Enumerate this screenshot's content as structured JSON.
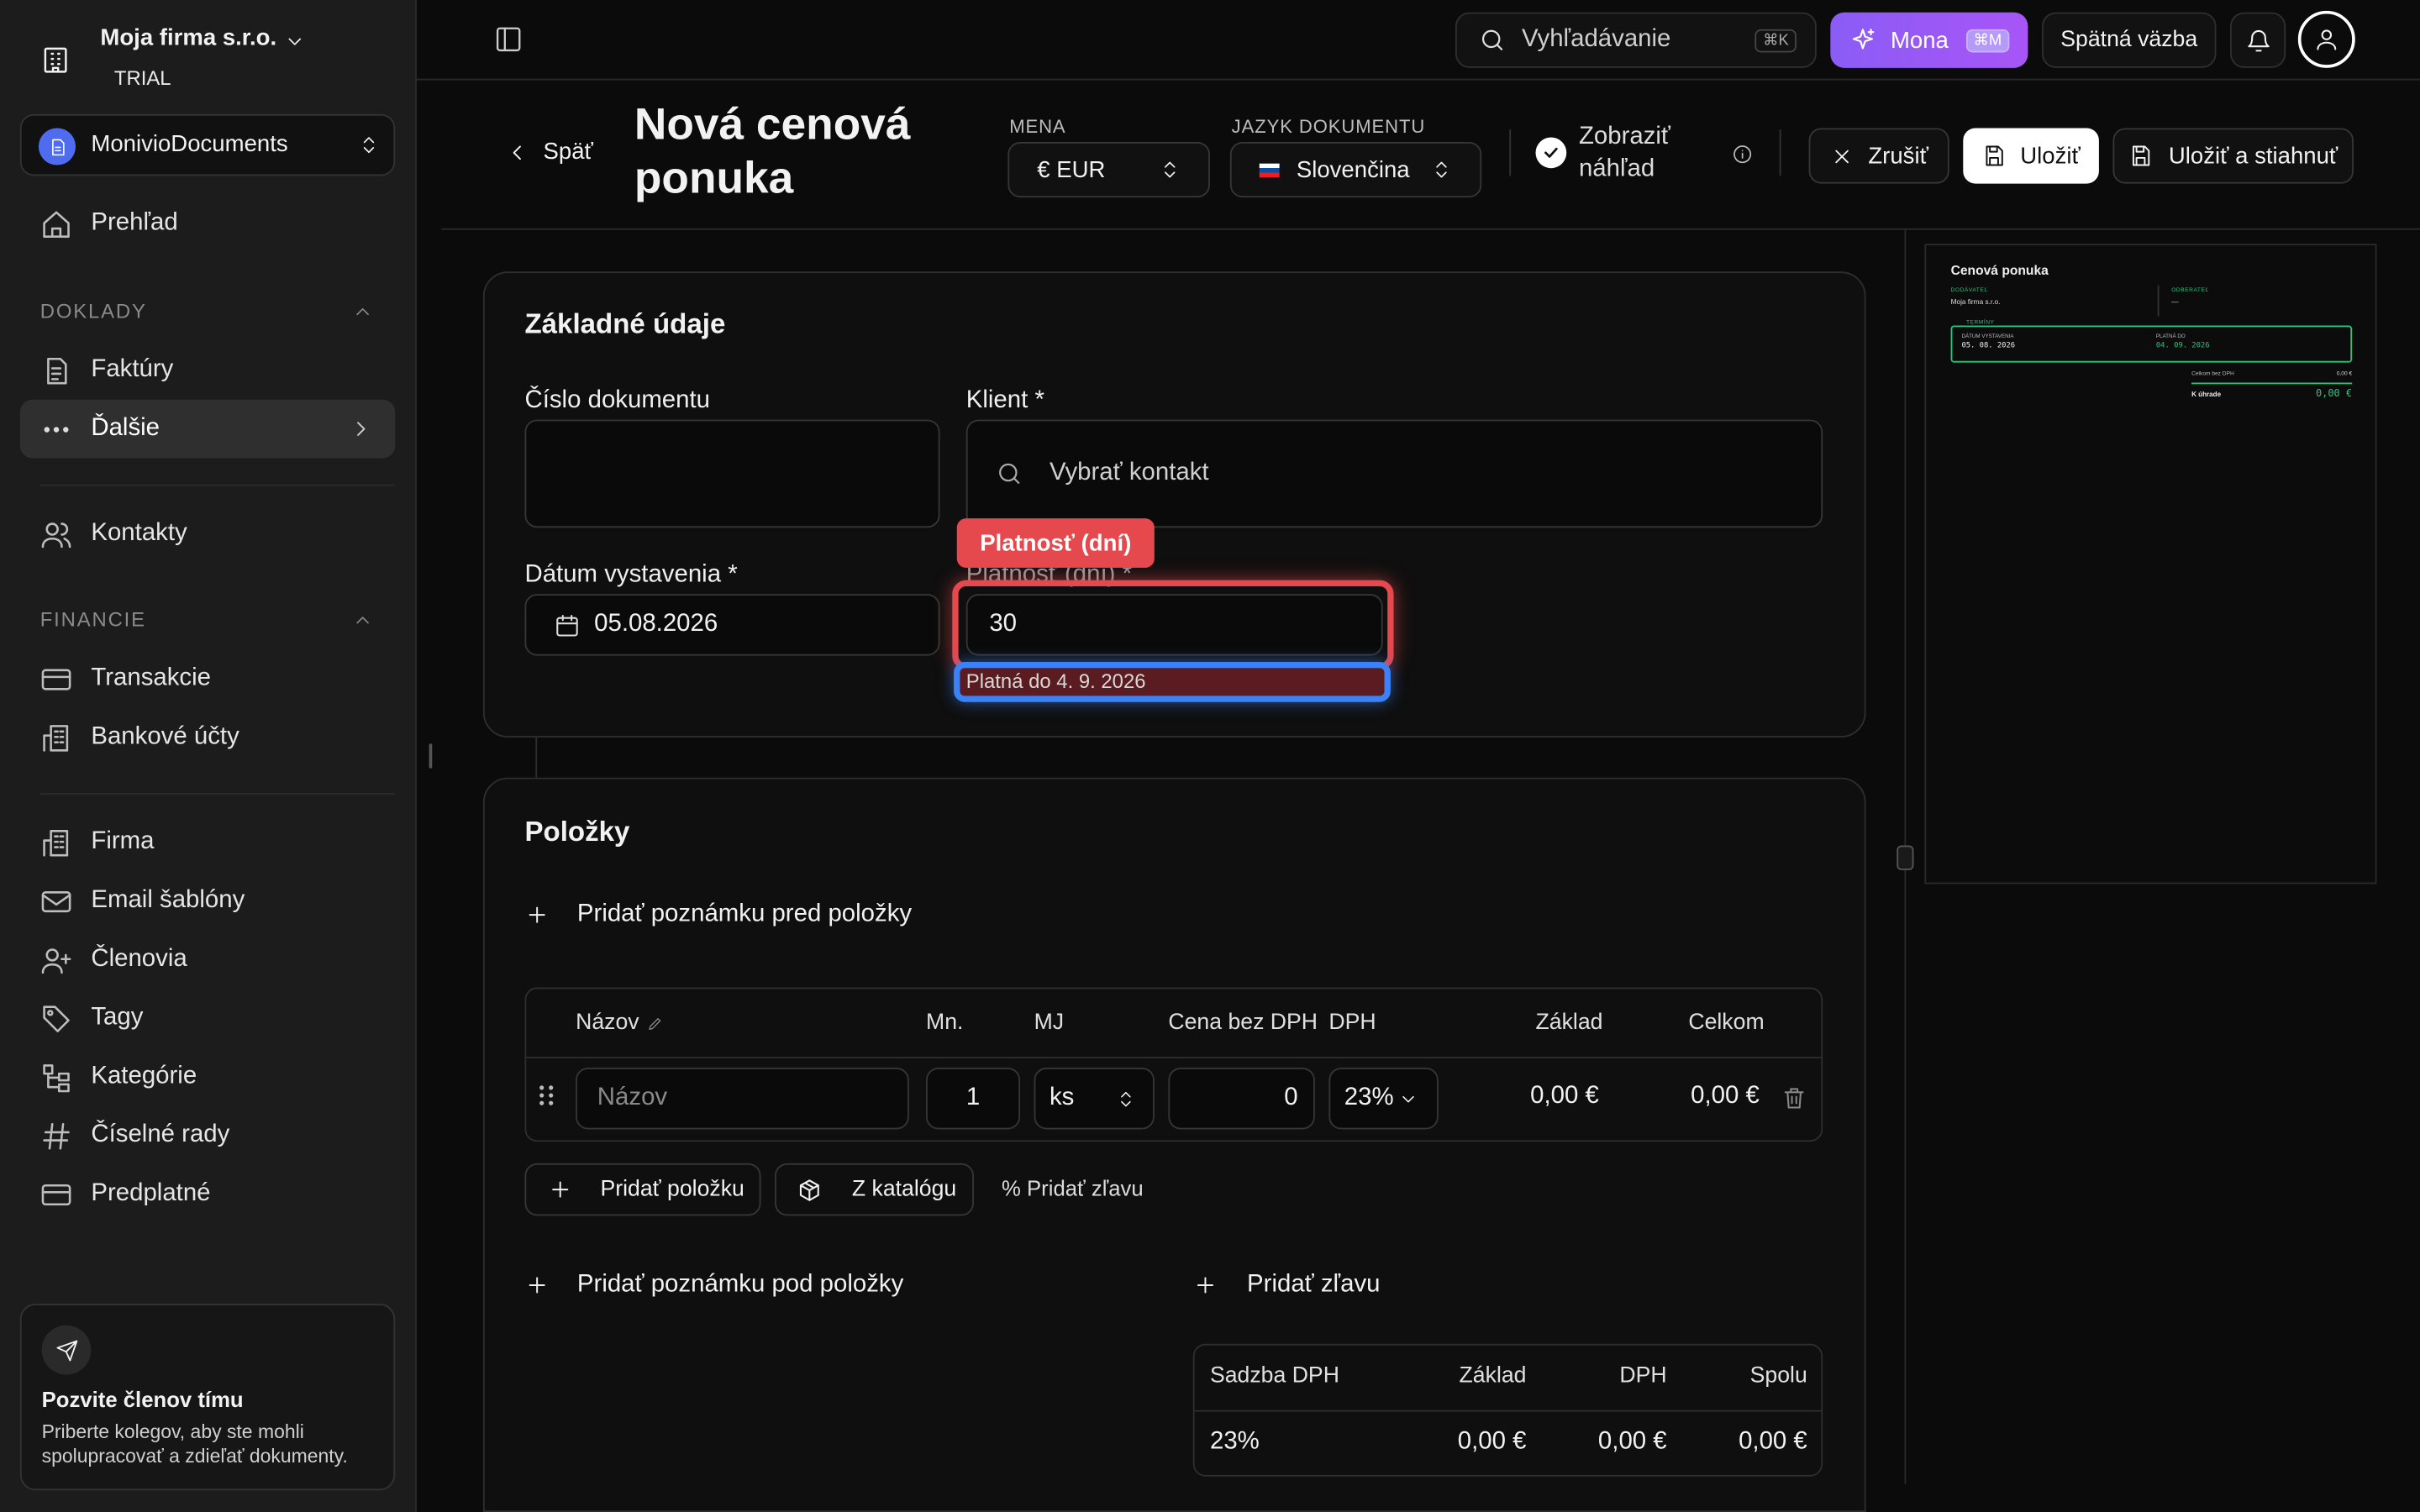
{
  "sidebar": {
    "company_name": "Moja firma s.r.o.",
    "plan_badge": "TRIAL",
    "workspace": "MonivioDocuments",
    "overview": "Prehľad",
    "section_documents": "DOKLADY",
    "invoices": "Faktúry",
    "more": "Ďalšie",
    "contacts": "Kontakty",
    "section_finance": "FINANCIE",
    "transactions": "Transakcie",
    "bank_accounts": "Bankové účty",
    "company": "Firma",
    "email_templates": "Email šablóny",
    "members": "Členovia",
    "tags": "Tagy",
    "categories": "Kategórie",
    "number_series": "Číselné rady",
    "subscription": "Predplatné",
    "invite_title": "Pozvite členov tímu",
    "invite_desc": "Priberte kolegov, aby ste mohli spolupracovať a zdieľať dokumenty."
  },
  "topbar": {
    "search_placeholder": "Vyhľadávanie",
    "search_shortcut": "⌘K",
    "assistant": "Mona",
    "assistant_shortcut": "⌘M",
    "feedback": "Spätná väzba"
  },
  "header": {
    "back": "Späť",
    "title_line1": "Nová cenová",
    "title_line2": "ponuka",
    "currency_label": "MENA",
    "currency_value": "€ EUR",
    "language_label": "JAZYK DOKUMENTU",
    "language_value": "Slovenčina",
    "show_preview_line1": "Zobraziť",
    "show_preview_line2": "náhľad",
    "cancel": "Zrušiť",
    "save": "Uložiť",
    "save_download": "Uložiť a stiahnuť"
  },
  "basic": {
    "title": "Základné údaje",
    "doc_number_label": "Číslo dokumentu",
    "doc_number_value": "",
    "client_label": "Klient *",
    "client_placeholder": "Vybrať kontakt",
    "issue_date_label": "Dátum vystavenia *",
    "issue_date_value": "05.08.2026",
    "validity_label": "Platnosť (dní) *",
    "validity_tooltip": "Platnosť (dní)",
    "validity_value": "30",
    "valid_until": "Platná do 4. 9. 2026"
  },
  "items": {
    "title": "Položky",
    "add_note_before": "Pridať poznámku pred položky",
    "columns": [
      "Názov",
      "Mn.",
      "MJ",
      "Cena bez DPH",
      "DPH",
      "Základ",
      "Celkom"
    ],
    "row": {
      "name_placeholder": "Názov",
      "qty": "1",
      "unit": "ks",
      "price": "0",
      "vat": "23%",
      "base": "0,00 €",
      "total": "0,00 €"
    },
    "add_item": "Pridať položku",
    "from_catalog": "Z katalógu",
    "add_discount_small": "% Pridať zľavu",
    "add_note_after": "Pridať poznámku pod položky",
    "add_discount": "Pridať zľavu",
    "vat_table": {
      "headers": [
        "Sadzba DPH",
        "Základ",
        "DPH",
        "Spolu"
      ],
      "row": [
        "23%",
        "0,00 €",
        "0,00 €",
        "0,00 €"
      ]
    }
  },
  "preview": {
    "title": "Cenová ponuka",
    "supplier_label": "DODÁVATEĽ",
    "supplier_value": "Moja firma s.r.o.",
    "customer_label": "ODBERATEĽ",
    "customer_value": "—",
    "terms_label": "TERMÍNY",
    "issue_label": "DÁTUM VYSTAVENIA",
    "issue_value": "05. 08. 2026",
    "valid_label": "PLATNÁ DO",
    "valid_value": "04. 09. 2026",
    "subtotal_label": "Celkom bez DPH",
    "subtotal_value": "0,00 €",
    "due_label": "K úhrade",
    "due_value": "0,00 €"
  },
  "colors": {
    "accent_purple": "#8b5cf6",
    "highlight_red": "#e5484d",
    "highlight_blue": "#3b82f6",
    "preview_green": "#2ec27e"
  }
}
